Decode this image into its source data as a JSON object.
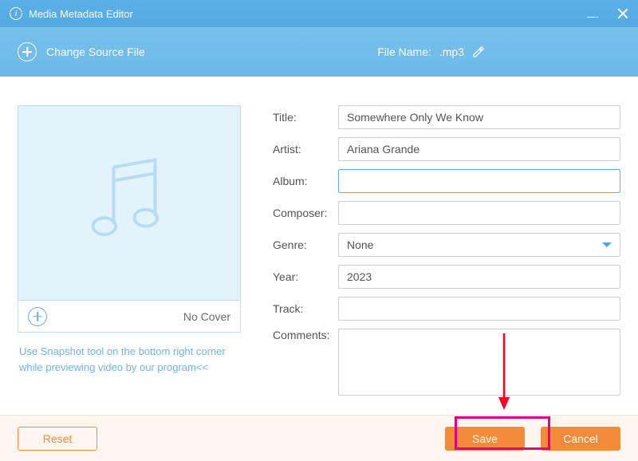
{
  "titlebar": {
    "title": "Media Metadata Editor"
  },
  "toolbar": {
    "change_source_label": "Change Source File",
    "filename_label": "File Name:",
    "filename_value": ".mp3"
  },
  "cover": {
    "no_cover_label": "No Cover",
    "hint_text": "Use Snapshot tool on the bottom right corner while previewing video by our program<<"
  },
  "form": {
    "title": {
      "label": "Title:",
      "value": "Somewhere Only We Know"
    },
    "artist": {
      "label": "Artist:",
      "value": "Ariana Grande"
    },
    "album": {
      "label": "Album:",
      "value": ""
    },
    "composer": {
      "label": "Composer:",
      "value": ""
    },
    "genre": {
      "label": "Genre:",
      "selected": "None"
    },
    "year": {
      "label": "Year:",
      "value": "2023"
    },
    "track": {
      "label": "Track:",
      "value": ""
    },
    "comments": {
      "label": "Comments:",
      "value": ""
    }
  },
  "footer": {
    "reset_label": "Reset",
    "save_label": "Save",
    "cancel_label": "Cancel"
  }
}
